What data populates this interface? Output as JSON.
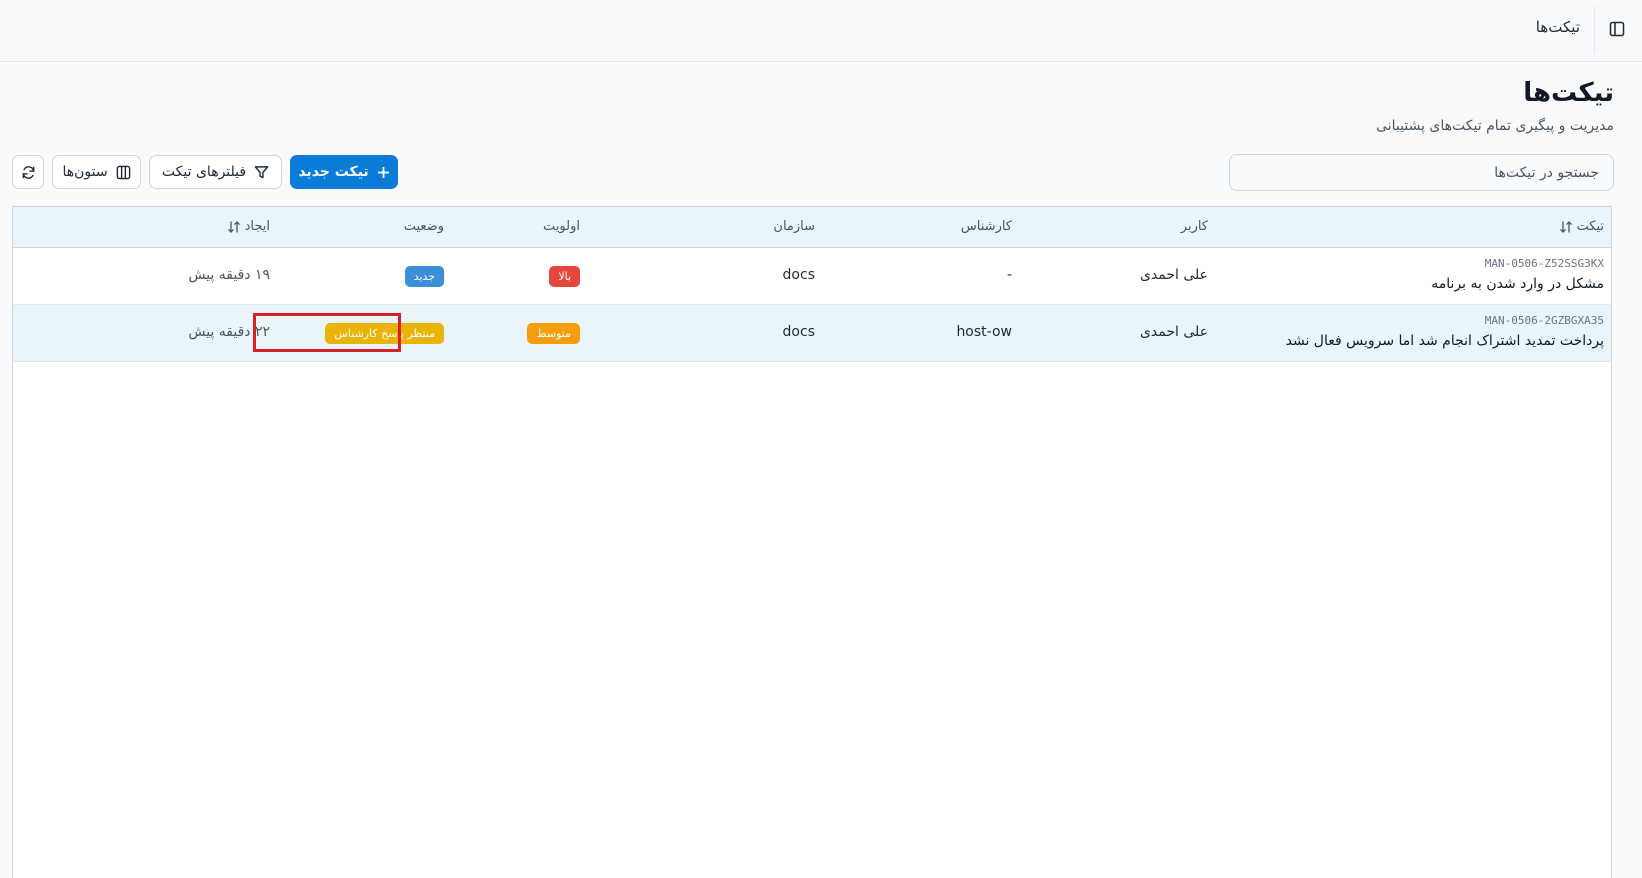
{
  "topbar": {
    "title": "تیکت‌ها"
  },
  "page": {
    "title": "تیکت‌ها",
    "subtitle": "مدیریت و پیگیری تمام تیکت‌های پشتیبانی"
  },
  "search": {
    "placeholder": "جستجو در تیکت‌ها"
  },
  "toolbar": {
    "new_ticket_label": "تیکت جدید",
    "filters_label": "فیلترهای تیکت",
    "columns_label": "ستون‌ها"
  },
  "table": {
    "headers": {
      "ticket": "تیکت",
      "user": "کاربر",
      "agent": "کارشناس",
      "organization": "سازمان",
      "priority": "اولویت",
      "status": "وضعیت",
      "created": "ایجاد"
    },
    "rows": [
      {
        "id": "MAN-0506-Z52SSG3KX",
        "title": "مشکل در وارد شدن به برنامه",
        "user": "علی احمدی",
        "agent": "-",
        "organization": "docs",
        "priority": "بالا",
        "status": "جدید",
        "created": "۱۹ دقیقه پیش"
      },
      {
        "id": "MAN-0506-2GZBGXA35",
        "title": "پرداخت تمدید اشتراک انجام شد اما سرویس فعال نشد",
        "user": "علی احمدی",
        "agent": "host-ow",
        "organization": "docs",
        "priority": "متوسط",
        "status": "منتظر پاسخ کارشناس",
        "created": "۲۲ دقیقه پیش"
      }
    ]
  },
  "colors": {
    "primary": "#0a7bd6",
    "priority_high": "#e5473d",
    "priority_medium": "#f59e0b",
    "status_new": "#3b8fd9",
    "status_waiting": "#eab308",
    "highlight": "#d91f26"
  }
}
